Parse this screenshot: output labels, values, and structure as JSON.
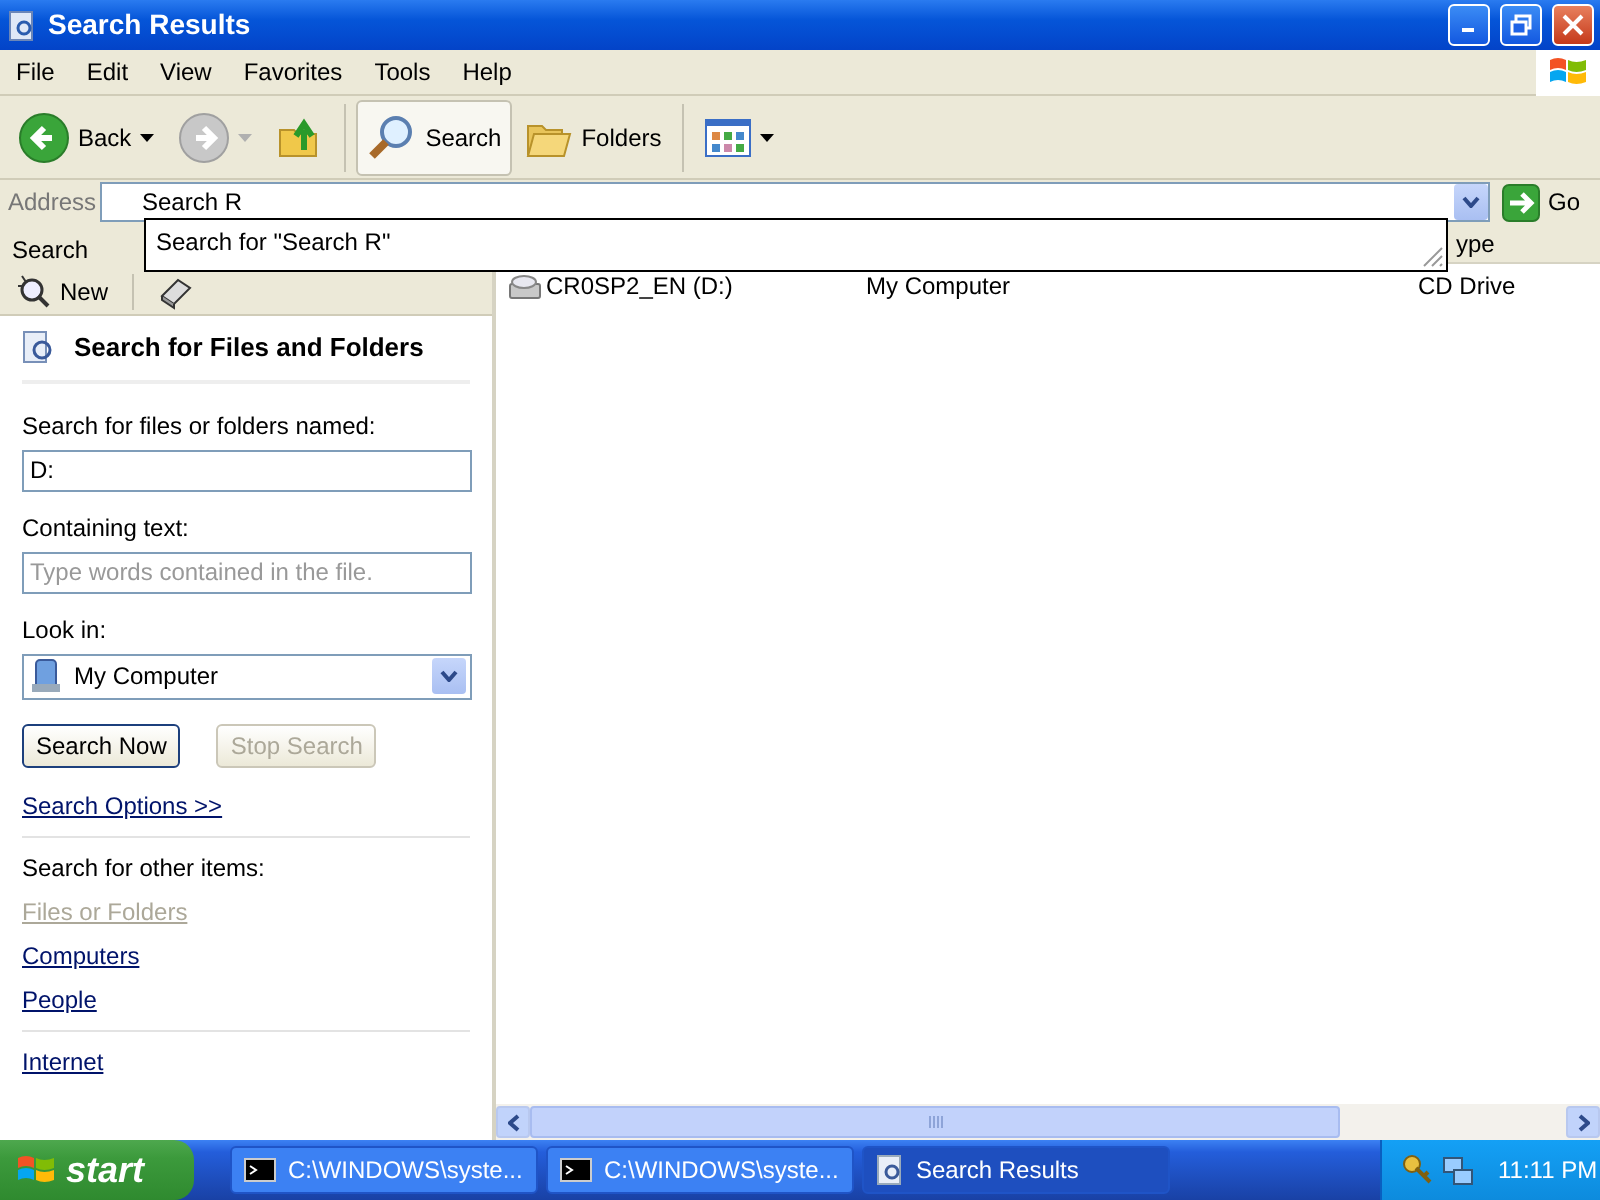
{
  "window": {
    "title": "Search Results"
  },
  "menu": [
    {
      "label": "File"
    },
    {
      "label": "Edit"
    },
    {
      "label": "View"
    },
    {
      "label": "Favorites"
    },
    {
      "label": "Tools"
    },
    {
      "label": "Help"
    }
  ],
  "toolbar": [
    {
      "kind": "back",
      "label": "Back",
      "disabled": false,
      "selected": false
    },
    {
      "kind": "forward",
      "disabled": true,
      "selected": false
    },
    {
      "kind": "up",
      "disabled": false,
      "selected": false
    },
    {
      "kind": "search",
      "label": "Search",
      "disabled": false,
      "selected": true
    },
    {
      "kind": "folders",
      "label": "Folders",
      "disabled": false,
      "selected": false
    },
    {
      "kind": "views",
      "disabled": false,
      "selected": false
    }
  ],
  "address": {
    "label": "Address",
    "value": "Search R",
    "go": "Go"
  },
  "autocomplete": [
    {
      "text": "Search for \"Search R\""
    }
  ],
  "search_pane": {
    "title": "Search",
    "new": "New",
    "heading": "Search for Files and Folders",
    "name_label": "Search for files or folders named:",
    "name_value": "D:",
    "text_label": "Containing text:",
    "text_placeholder": "Type words contained in the file.",
    "look_in_label": "Look in:",
    "look_in_value": "My Computer",
    "buttons": [
      {
        "label": "Search Now",
        "disabled": false
      },
      {
        "label": "Stop Search",
        "disabled": true
      }
    ],
    "options_link": "Search Options >>",
    "other_label": "Search for other items:",
    "other_links": [
      {
        "label": "Files or Folders",
        "disabled": true
      },
      {
        "label": "Computers",
        "disabled": false
      },
      {
        "label": "People",
        "disabled": false
      }
    ],
    "internet_link": "Internet"
  },
  "results": {
    "column_header": "ype",
    "rows": [
      {
        "name": "CR0SP2_EN (D:)",
        "in_folder": "My Computer",
        "type": "CD Drive"
      }
    ]
  },
  "taskbar": {
    "start": "start",
    "tasks": [
      {
        "kind": "console",
        "label": "C:\\WINDOWS\\syste...",
        "selected": false
      },
      {
        "kind": "console",
        "label": "C:\\WINDOWS\\syste...",
        "selected": false
      },
      {
        "kind": "search",
        "label": "Search Results",
        "selected": true
      }
    ],
    "clock": "11:11 PM"
  }
}
